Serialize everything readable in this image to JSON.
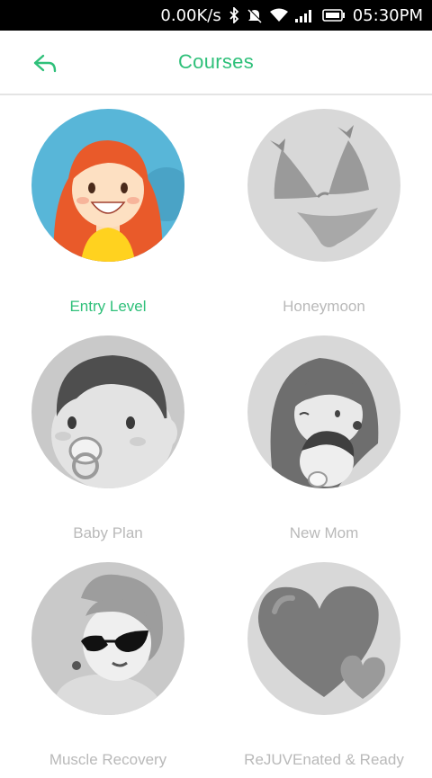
{
  "status_bar": {
    "speed": "0.00K/s",
    "time": "05:30PM",
    "icons": [
      "bluetooth-icon",
      "silent-icon",
      "wifi-icon",
      "signal-icon",
      "battery-icon"
    ]
  },
  "header": {
    "back_icon": "back-arrow-icon",
    "title": "Courses"
  },
  "colors": {
    "accent": "#2fc07a",
    "inactive_text": "#b9b9b9",
    "active_circle_bg": "#58b6d8"
  },
  "courses": [
    {
      "label": "Entry Level",
      "active": true,
      "icon": "girl-avatar-icon"
    },
    {
      "label": "Honeymoon",
      "active": false,
      "icon": "bikini-icon"
    },
    {
      "label": "Baby Plan",
      "active": false,
      "icon": "baby-pacifier-icon"
    },
    {
      "label": "New Mom",
      "active": false,
      "icon": "mom-and-baby-icon"
    },
    {
      "label": "Muscle Recovery",
      "active": false,
      "icon": "woman-sunglasses-icon"
    },
    {
      "label": "ReJUVEnated & Ready",
      "active": false,
      "icon": "hearts-icon"
    }
  ]
}
